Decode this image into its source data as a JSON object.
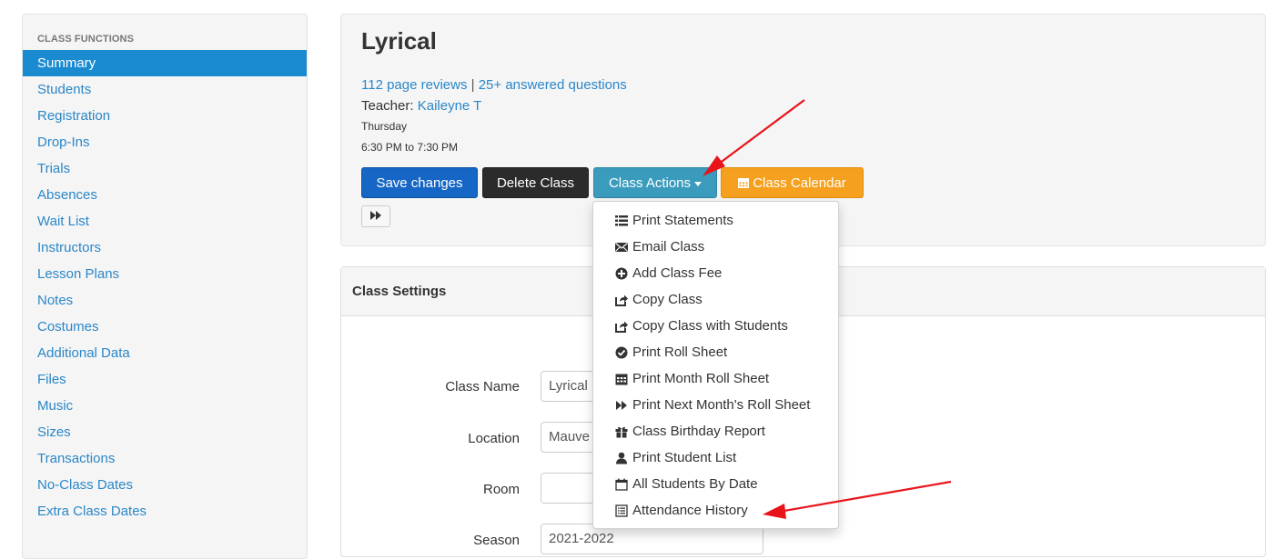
{
  "sidebar": {
    "header": "CLASS FUNCTIONS",
    "items": [
      {
        "label": "Summary"
      },
      {
        "label": "Students"
      },
      {
        "label": "Registration"
      },
      {
        "label": "Drop-Ins"
      },
      {
        "label": "Trials"
      },
      {
        "label": "Absences"
      },
      {
        "label": "Wait List"
      },
      {
        "label": "Instructors"
      },
      {
        "label": "Lesson Plans"
      },
      {
        "label": "Notes"
      },
      {
        "label": "Costumes"
      },
      {
        "label": "Additional Data"
      },
      {
        "label": "Files"
      },
      {
        "label": "Music"
      },
      {
        "label": "Sizes"
      },
      {
        "label": "Transactions"
      },
      {
        "label": "No-Class Dates"
      },
      {
        "label": "Extra Class Dates"
      }
    ]
  },
  "class": {
    "title": "Lyrical",
    "reviews": "112 page reviews",
    "separator": "|",
    "questions": "25+ answered questions",
    "teacher_label": "Teacher:",
    "teacher_name": "Kaileyne T",
    "day": "Thursday",
    "time": "6:30 PM to 7:30 PM"
  },
  "buttons": {
    "save": "Save changes",
    "delete": "Delete Class",
    "actions": "Class Actions",
    "calendar": "Class Calendar"
  },
  "actions_menu": [
    {
      "label": "Print Statements",
      "icon": "list-icon"
    },
    {
      "label": "Email Class",
      "icon": "envelope-icon"
    },
    {
      "label": "Add Class Fee",
      "icon": "plus-circle-icon"
    },
    {
      "label": "Copy Class",
      "icon": "share-icon"
    },
    {
      "label": "Copy Class with Students",
      "icon": "share-icon"
    },
    {
      "label": "Print Roll Sheet",
      "icon": "check-circle-icon"
    },
    {
      "label": "Print Month Roll Sheet",
      "icon": "calendar-icon"
    },
    {
      "label": "Print Next Month's Roll Sheet",
      "icon": "fast-forward-icon"
    },
    {
      "label": "Class Birthday Report",
      "icon": "gift-icon"
    },
    {
      "label": "Print Student List",
      "icon": "user-icon"
    },
    {
      "label": "All Students By Date",
      "icon": "calendar-outline-icon"
    },
    {
      "label": "Attendance History",
      "icon": "list-alt-icon"
    }
  ],
  "settings": {
    "header": "Class Settings",
    "fields": [
      {
        "label": "Class Name",
        "value": "Lyrical"
      },
      {
        "label": "Location",
        "value": "Mauve"
      },
      {
        "label": "Room",
        "value": ""
      },
      {
        "label": "Season",
        "value": "2021-2022"
      }
    ]
  },
  "colors": {
    "accent": "#1a8ad1",
    "save": "#1666c6",
    "delete": "#2b2b2b",
    "actions": "#3a9bbd",
    "calendar": "#f5a01e",
    "annotation_arrow": "#e8141b"
  }
}
